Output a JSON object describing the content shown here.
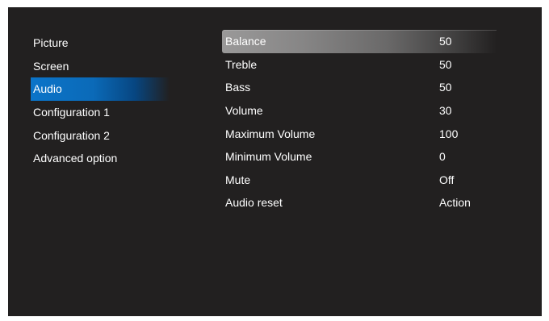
{
  "menu": {
    "items": [
      {
        "label": "Picture"
      },
      {
        "label": "Screen"
      },
      {
        "label": "Audio"
      },
      {
        "label": "Configuration 1"
      },
      {
        "label": "Configuration 2"
      },
      {
        "label": "Advanced option"
      }
    ],
    "selected": "Audio"
  },
  "audio_settings": {
    "highlighted": "Balance",
    "rows": [
      {
        "label": "Balance",
        "value": "50"
      },
      {
        "label": "Treble",
        "value": "50"
      },
      {
        "label": "Bass",
        "value": "50"
      },
      {
        "label": "Volume",
        "value": "30"
      },
      {
        "label": "Maximum Volume",
        "value": "100"
      },
      {
        "label": "Minimum Volume",
        "value": "0"
      },
      {
        "label": "Mute",
        "value": "Off"
      },
      {
        "label": "Audio reset",
        "value": "Action"
      }
    ]
  },
  "colors": {
    "background": "#222020",
    "selected_menu": "#0b74c9",
    "highlighted_row": "#9a9999",
    "text": "#ffffff"
  }
}
